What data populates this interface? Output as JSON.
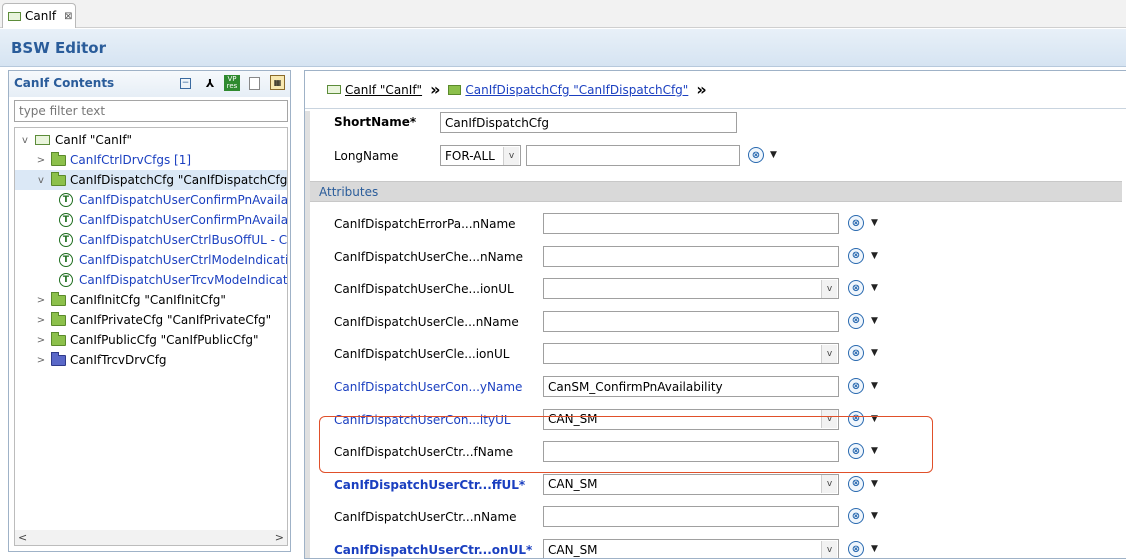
{
  "tab": {
    "label": "CanIf",
    "close": "⊠"
  },
  "editor": {
    "title": "BSW Editor"
  },
  "contents": {
    "title": "CanIf Contents",
    "filter_placeholder": "type filter text",
    "tree": [
      {
        "label": "CanIf \"CanIf\"",
        "icon": "module-icon",
        "expander": "v",
        "indent": 0,
        "link": false
      },
      {
        "label": "CanIfCtrlDrvCfgs [1]",
        "icon": "folder-icon",
        "expander": ">",
        "indent": 1,
        "link": true
      },
      {
        "label": "CanIfDispatchCfg \"CanIfDispatchCfg\"",
        "icon": "folder-icon",
        "expander": "v",
        "indent": 1,
        "link": false,
        "selected": true
      },
      {
        "label": "CanIfDispatchUserConfirmPnAvailabilityName",
        "icon": "t-icon",
        "expander": "",
        "indent": 2,
        "link": true
      },
      {
        "label": "CanIfDispatchUserConfirmPnAvailabilityUL",
        "icon": "t-icon",
        "expander": "",
        "indent": 2,
        "link": true
      },
      {
        "label": "CanIfDispatchUserCtrlBusOffUL - CAN_SM",
        "icon": "t-icon",
        "expander": "",
        "indent": 2,
        "link": true
      },
      {
        "label": "CanIfDispatchUserCtrlModeIndicationUL",
        "icon": "t-icon",
        "expander": "",
        "indent": 2,
        "link": true
      },
      {
        "label": "CanIfDispatchUserTrcvModeIndicationUL",
        "icon": "t-icon",
        "expander": "",
        "indent": 2,
        "link": true
      },
      {
        "label": "CanIfInitCfg \"CanIfInitCfg\"",
        "icon": "folder-icon",
        "expander": ">",
        "indent": 1,
        "link": false
      },
      {
        "label": "CanIfPrivateCfg \"CanIfPrivateCfg\"",
        "icon": "folder-icon",
        "expander": ">",
        "indent": 1,
        "link": false
      },
      {
        "label": "CanIfPublicCfg \"CanIfPublicCfg\"",
        "icon": "folder-icon",
        "expander": ">",
        "indent": 1,
        "link": false
      },
      {
        "label": "CanIfTrcvDrvCfg",
        "icon": "folder-icon-blue",
        "expander": ">",
        "indent": 1,
        "link": false
      }
    ]
  },
  "breadcrumb": {
    "item1": "CanIf \"CanIf\"",
    "item2": "CanIfDispatchCfg \"CanIfDispatchCfg\"",
    "sep": "»"
  },
  "form": {
    "shortname_label": "ShortName*",
    "shortname_value": "CanIfDispatchCfg",
    "longname_label": "LongName",
    "longname_lang": "FOR-ALL",
    "longname_value": "",
    "attributes_title": "Attributes",
    "fields": [
      {
        "label": "CanIfDispatchErrorPa...nName",
        "kind": "text",
        "value": "",
        "style": "normal"
      },
      {
        "label": "CanIfDispatchUserChe...nName",
        "kind": "text",
        "value": "",
        "style": "normal"
      },
      {
        "label": "CanIfDispatchUserChe...ionUL",
        "kind": "select",
        "value": "",
        "style": "normal"
      },
      {
        "label": "CanIfDispatchUserCle...nName",
        "kind": "text",
        "value": "",
        "style": "normal"
      },
      {
        "label": "CanIfDispatchUserCle...ionUL",
        "kind": "select",
        "value": "",
        "style": "normal"
      },
      {
        "label": "CanIfDispatchUserCon...yName",
        "kind": "text",
        "value": "CanSM_ConfirmPnAvailability",
        "style": "link"
      },
      {
        "label": "CanIfDispatchUserCon...ityUL",
        "kind": "select",
        "value": "CAN_SM",
        "style": "link"
      },
      {
        "label": "CanIfDispatchUserCtr...fName",
        "kind": "text",
        "value": "",
        "style": "normal"
      },
      {
        "label": "CanIfDispatchUserCtr...ffUL*",
        "kind": "select",
        "value": "CAN_SM",
        "style": "boldlink"
      },
      {
        "label": "CanIfDispatchUserCtr...nName",
        "kind": "text",
        "value": "",
        "style": "normal"
      },
      {
        "label": "CanIfDispatchUserCtr...onUL*",
        "kind": "select",
        "value": "CAN_SM",
        "style": "boldlink"
      }
    ]
  },
  "icons": {
    "action": "⊗",
    "dropdown": "▼",
    "select_arrow": "v",
    "scroll_left": "<",
    "scroll_right": ">"
  }
}
